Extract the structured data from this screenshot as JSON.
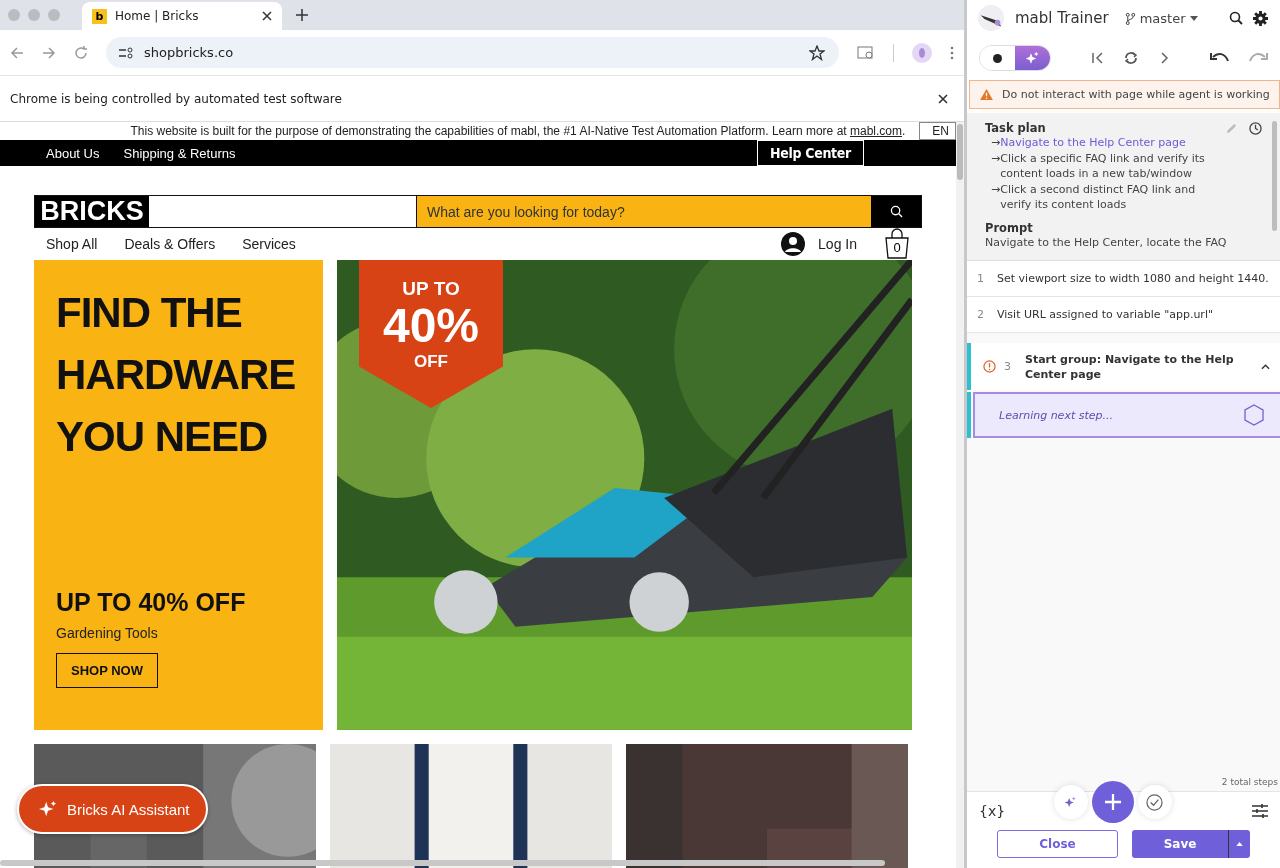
{
  "browser": {
    "tab": {
      "favicon": "b",
      "title": "Home | Bricks"
    },
    "address": "shopbricks.co",
    "infobar": "Chrome is being controlled by automated test software"
  },
  "site": {
    "banner": {
      "text": "This website is built for the purpose of demonstrating the capabilities of mabl, the #1 AI-Native Test Automation Platform.  Learn more at",
      "link": "mabl.com",
      "tail": ".",
      "lang": "EN"
    },
    "top_nav": [
      "About Us",
      "Shipping & Returns"
    ],
    "help_button": "Help Center",
    "logo": "BRICKS",
    "search": {
      "placeholder": "What are you looking for today?"
    },
    "nav": [
      "Shop All",
      "Deals & Offers",
      "Services"
    ],
    "login": "Log In",
    "cart_count": "0",
    "hero": {
      "title": [
        "FIND THE",
        "HARDWARE",
        "YOU NEED"
      ],
      "offer": "UP TO 40% OFF",
      "subtitle": "Gardening Tools",
      "button": "SHOP NOW"
    },
    "promo": {
      "top": "UP TO",
      "big": "40%",
      "bottom": "OFF"
    },
    "assistant": "Bricks AI Assistant"
  },
  "panel": {
    "title": "mabl Trainer",
    "branch": "master",
    "modes": [
      {
        "kind": "record",
        "selected": false
      },
      {
        "kind": "ai",
        "selected": true
      }
    ],
    "warning": "Do not interact with page while agent is working",
    "task_plan": {
      "heading": "Task plan",
      "items": [
        {
          "bullet": "→",
          "text": "Navigate to the Help Center page",
          "current": true
        },
        {
          "bullet": "→",
          "text": "Click a specific FAQ link and verify its content loads in a new tab/window",
          "current": false
        },
        {
          "bullet": "→",
          "text": "Click a second distinct FAQ link and verify its content loads",
          "current": false
        }
      ]
    },
    "prompt": {
      "heading": "Prompt",
      "text": "Navigate to the Help Center, locate the FAQ"
    },
    "steps": [
      {
        "kind": "step",
        "number": "1",
        "text": "Set viewport size to width 1080 and height 1440.",
        "warning": false
      },
      {
        "kind": "step",
        "number": "2",
        "text": "Visit URL assigned to variable \"app.url\"",
        "warning": false
      },
      {
        "kind": "group",
        "number": "3",
        "text": "Start group: Navigate to the Help Center page",
        "warning": true,
        "expanded": true
      }
    ],
    "learning": "Learning next step...",
    "total": "2 total steps",
    "variables": "{x}",
    "close": "Close",
    "save": "Save"
  }
}
